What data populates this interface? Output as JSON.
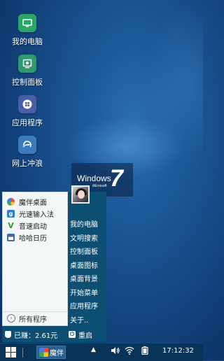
{
  "desktop": {
    "icons": [
      {
        "label": "我的电脑",
        "icon": "computer-icon",
        "color": "#2aa56a"
      },
      {
        "label": "控制面板",
        "icon": "control-panel-icon",
        "color": "#2f9a6d"
      },
      {
        "label": "应用程序",
        "icon": "apps-icon",
        "color": "#4a5ea8"
      },
      {
        "label": "网上冲浪",
        "icon": "browser-icon",
        "color": "#3a7bbd"
      }
    ],
    "banner": {
      "word": "Windows",
      "brand": "Microsoft",
      "version": "7"
    }
  },
  "start_menu": {
    "programs": [
      {
        "label": "魔伴桌面",
        "icon": "pinwheel-icon"
      },
      {
        "label": "光速输入法",
        "icon": "input-method-icon"
      },
      {
        "label": "音速启动",
        "icon": "launcher-icon"
      },
      {
        "label": "哈哈日历",
        "icon": "calendar-icon"
      }
    ],
    "all_programs": "所有程序",
    "links": [
      "我的电脑",
      "文明搜索",
      "控制面板",
      "桌面图标",
      "桌面背景",
      "开始菜单",
      "应用程序",
      "关于.."
    ],
    "earned": "已赚：2.61元",
    "restart": "重启"
  },
  "taskbar": {
    "task_label": "魔伴",
    "clock": "17:12:32",
    "accent": "#0a3358"
  }
}
